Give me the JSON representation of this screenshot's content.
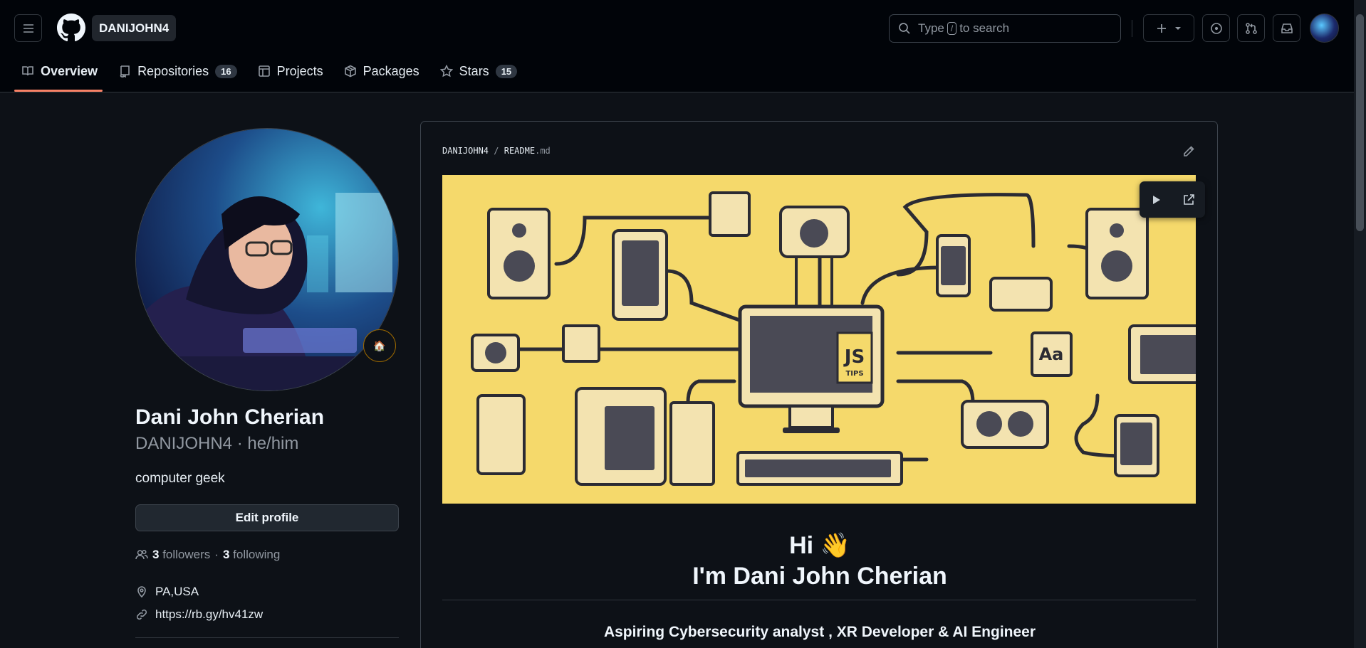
{
  "header": {
    "context_label": "DANIJOHN4",
    "search": {
      "prefix": "Type",
      "key": "/",
      "suffix": "to search"
    }
  },
  "tabs": [
    {
      "label": "Overview",
      "active": true,
      "icon": "book-icon"
    },
    {
      "label": "Repositories",
      "count": "16",
      "icon": "repo-icon"
    },
    {
      "label": "Projects",
      "icon": "table-icon"
    },
    {
      "label": "Packages",
      "icon": "package-icon"
    },
    {
      "label": "Stars",
      "count": "15",
      "icon": "star-icon"
    }
  ],
  "profile": {
    "status_emoji": "🏠",
    "full_name": "Dani John Cherian",
    "username_line": "DANIJOHN4 · he/him",
    "bio": "computer geek",
    "edit_label": "Edit profile",
    "followers_count": "3",
    "followers_label": "followers",
    "following_count": "3",
    "following_label": "following",
    "location": "PA,USA",
    "link": "https://rb.gy/hv41zw"
  },
  "readme": {
    "owner": "DANIJOHN4",
    "separator": "/",
    "file_name": "README",
    "file_ext": ".md",
    "banner_badge": "JS",
    "banner_badge_sub": "TIPS",
    "banner_aa": "Aa",
    "greeting": "Hi 👋",
    "heading": "I'm Dani John Cherian",
    "tagline": "Aspiring Cybersecurity analyst , XR Developer & AI Engineer"
  },
  "colors": {
    "background": "#0d1117",
    "header": "#010409",
    "accent": "#f78166",
    "banner": "#f5d96b"
  }
}
